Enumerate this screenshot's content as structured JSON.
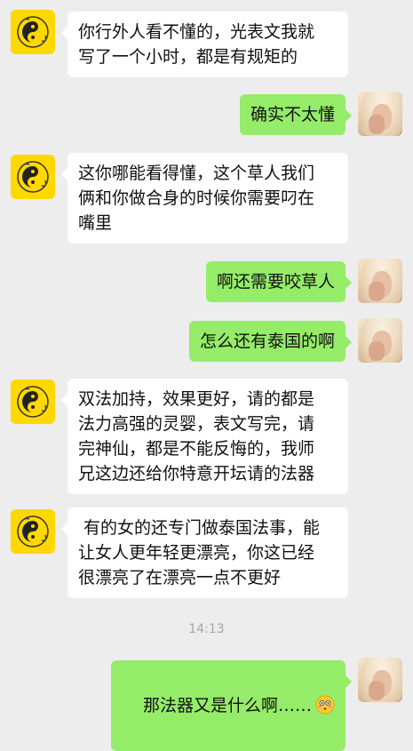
{
  "messages": [
    {
      "side": "left",
      "text": "你行外人看不懂的，光表文我就\n写了一个小时，都是有规矩的"
    },
    {
      "side": "right",
      "text": "确实不太懂"
    },
    {
      "side": "left",
      "text": "这你哪能看得懂，这个草人我们\n俩和你做合身的时候你需要叼在\n嘴里"
    },
    {
      "side": "right",
      "text": "啊还需要咬草人"
    },
    {
      "side": "right",
      "text": "怎么还有泰国的啊"
    },
    {
      "side": "left",
      "text": "双法加持，效果更好，请的都是\n法力高强的灵婴，表文写完，请\n完神仙，都是不能反悔的，我师\n兄这边还给你特意开坛请的法器"
    },
    {
      "side": "left",
      "text": " 有的女的还专门做泰国法事，能\n让女人更年轻更漂亮，你这已经\n很漂亮了在漂亮一点不更好"
    },
    {
      "side": "right",
      "text": "那法器又是什么啊……",
      "emoji": "flushed-face-emoji"
    }
  ],
  "timestamp": "14:13",
  "colors": {
    "background": "#ededed",
    "incoming_bubble": "#ffffff",
    "outgoing_bubble": "#95ec69",
    "left_avatar_bg": "#ffd800"
  },
  "icons": {
    "left_avatar": "taiji-dragon-logo",
    "right_avatar": "user-photo",
    "emoji": "flushed-face-emoji"
  }
}
